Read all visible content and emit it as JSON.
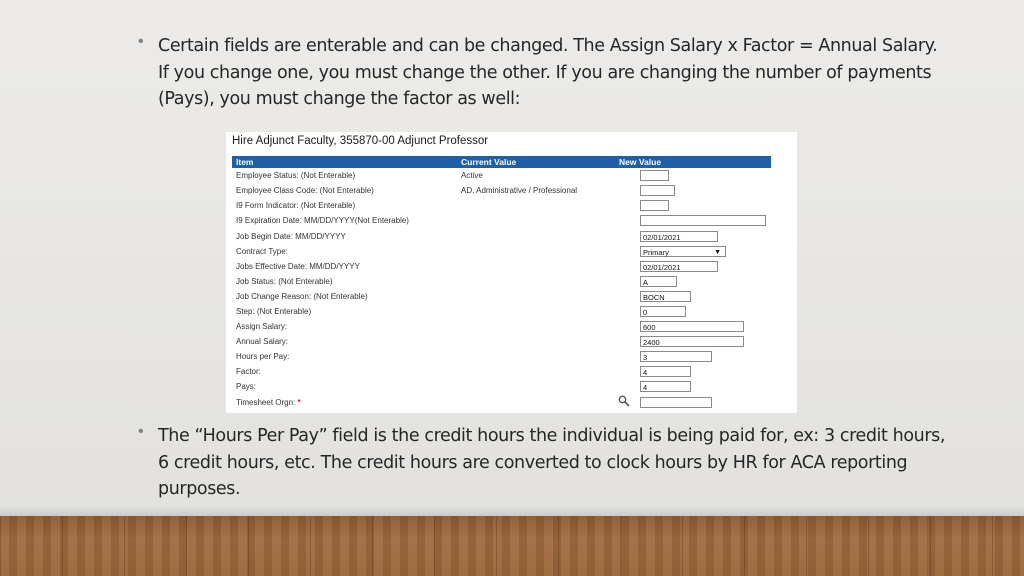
{
  "slide": {
    "bullet1": "Certain fields are enterable and can be changed.  The Assign Salary x Factor = Annual Salary.  If you change one, you must change the other.  If you are changing the number of payments (Pays), you must change the factor as well:",
    "bullet2": "The “Hours Per Pay” field is the credit hours the individual is being paid for, ex: 3 credit hours, 6 credit hours, etc.  The credit hours are converted to clock hours by HR for ACA reporting purposes.",
    "bullet_glyph": "•"
  },
  "form": {
    "title": "Hire Adjunct Faculty, 355870-00 Adjunct Professor",
    "headers": {
      "item": "Item",
      "current": "Current Value",
      "new": "New Value"
    },
    "rows": [
      {
        "label": "Employee Status: (Not Enterable)",
        "current": "Active",
        "value": ""
      },
      {
        "label": "Employee Class Code: (Not Enterable)",
        "current": "AD, Administrative / Professional",
        "value": ""
      },
      {
        "label": "I9 Form Indicator: (Not Enterable)",
        "current": "",
        "value": ""
      },
      {
        "label": "I9 Expiration Date: MM/DD/YYYY(Not Enterable)",
        "current": "",
        "value": ""
      },
      {
        "label": "Job Begin Date: MM/DD/YYYY",
        "current": "",
        "value": "02/01/2021"
      },
      {
        "label": "Contract Type:",
        "current": "",
        "value": "Primary"
      },
      {
        "label": "Jobs Effective Date: MM/DD/YYYY",
        "current": "",
        "value": "02/01/2021"
      },
      {
        "label": "Job Status: (Not Enterable)",
        "current": "",
        "value": "A"
      },
      {
        "label": "Job Change Reason: (Not Enterable)",
        "current": "",
        "value": "BOCN"
      },
      {
        "label": "Step: (Not Enterable)",
        "current": "",
        "value": "0"
      },
      {
        "label": "Assign Salary:",
        "current": "",
        "value": "600"
      },
      {
        "label": "Annual Salary:",
        "current": "",
        "value": "2400"
      },
      {
        "label": "Hours per Pay:",
        "current": "",
        "value": "3"
      },
      {
        "label": "Factor:",
        "current": "",
        "value": "4"
      },
      {
        "label": "Pays:",
        "current": "",
        "value": "4"
      },
      {
        "label": "Timesheet Orgn:",
        "current": "",
        "value": "",
        "required_mark": "*"
      }
    ],
    "icons": {
      "dropdown": "chevron-down-icon",
      "search": "magnifier-icon"
    }
  }
}
